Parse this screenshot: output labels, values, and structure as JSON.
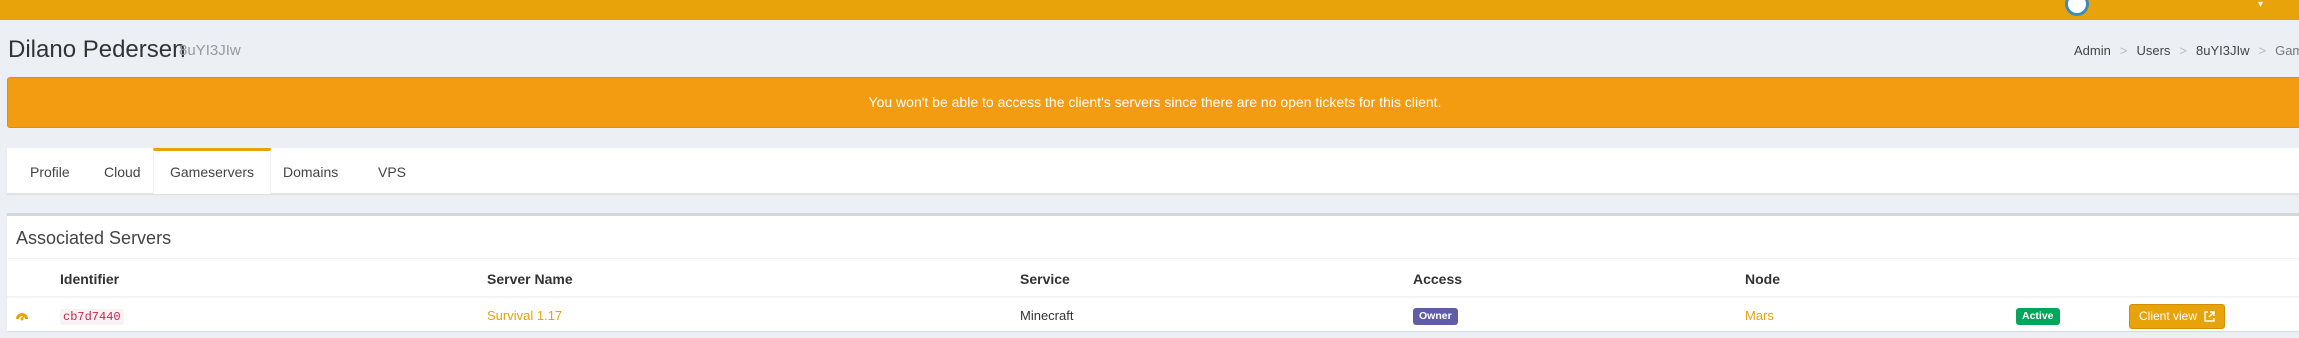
{
  "page": {
    "title": "Dilano Pedersen",
    "subtitle": "8uYI3JIw"
  },
  "breadcrumb": [
    "Admin",
    "Users",
    "8uYI3JIw",
    "Gameserve"
  ],
  "alert": {
    "text": "You won't be able to access the client's servers since there are no open tickets for this client."
  },
  "tabs": [
    {
      "label": "Profile"
    },
    {
      "label": "Cloud"
    },
    {
      "label": "Gameservers",
      "active": true
    },
    {
      "label": "Domains"
    },
    {
      "label": "VPS"
    }
  ],
  "panel": {
    "title": "Associated Servers",
    "columns": [
      "Identifier",
      "Server Name",
      "Service",
      "Access",
      "Node"
    ],
    "rows": [
      {
        "icon": "gauge-icon",
        "identifier": "cb7d7440",
        "server_name": "Survival 1.17",
        "service": "Minecraft",
        "access": "Owner",
        "node": "Mars",
        "status": "Active",
        "action": "Client view"
      }
    ]
  },
  "colors": {
    "accent": "#e8a20a",
    "alert": "#f39c12",
    "owner_badge": "#605ca8",
    "active_badge": "#00a65a"
  }
}
